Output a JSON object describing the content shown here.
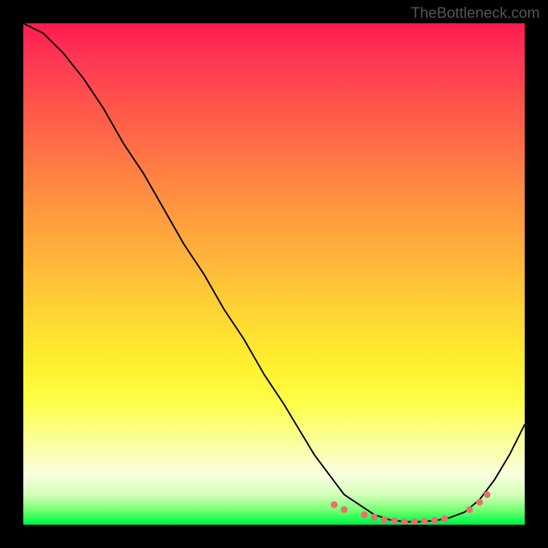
{
  "watermark": "TheBottleneck.com",
  "chart_data": {
    "type": "line",
    "title": "",
    "xlabel": "",
    "ylabel": "",
    "xlim": [
      0,
      100
    ],
    "ylim": [
      0,
      100
    ],
    "grid": false,
    "series": [
      {
        "name": "main-curve",
        "x": [
          0,
          4,
          8,
          12,
          16,
          20,
          24,
          28,
          32,
          36,
          40,
          44,
          48,
          52,
          55,
          58,
          61,
          64,
          67,
          70,
          73,
          76,
          79,
          82,
          85,
          88,
          91,
          94,
          97,
          100
        ],
        "values": [
          100,
          98,
          94,
          89,
          83,
          76,
          70,
          63,
          56,
          50,
          43,
          37,
          30,
          24,
          19,
          14,
          10,
          6,
          4,
          2,
          1,
          0.6,
          0.6,
          0.8,
          1.4,
          2.5,
          5,
          9,
          14,
          20
        ]
      }
    ],
    "highlight_points": {
      "x": [
        62,
        64,
        68,
        70,
        72,
        74,
        76,
        78,
        80,
        82,
        84,
        89,
        91,
        92.5
      ],
      "values": [
        4,
        3,
        2,
        1.5,
        1,
        0.8,
        0.6,
        0.6,
        0.7,
        0.9,
        1.2,
        3,
        4.5,
        6
      ]
    },
    "gradient_colors": {
      "top": "#ff1a4d",
      "mid": "#ffd634",
      "bottom": "#00e84a"
    }
  }
}
